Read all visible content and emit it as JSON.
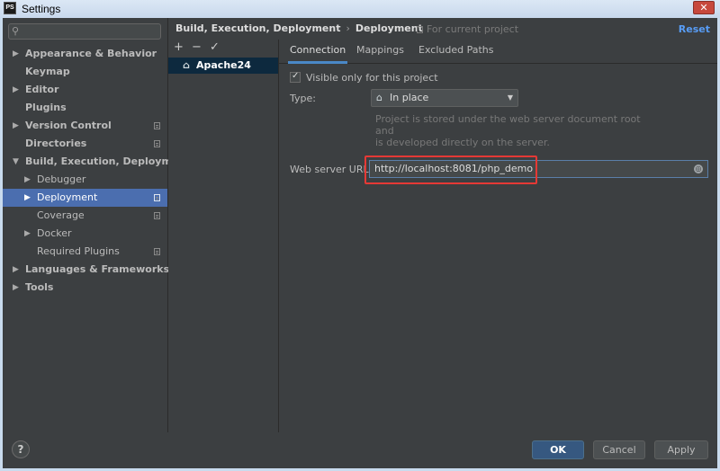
{
  "window": {
    "title": "Settings",
    "close_glyph": "✕"
  },
  "sidebar": {
    "search_placeholder": "",
    "items": [
      {
        "label": "Appearance & Behavior"
      },
      {
        "label": "Keymap"
      },
      {
        "label": "Editor"
      },
      {
        "label": "Plugins"
      },
      {
        "label": "Version Control"
      },
      {
        "label": "Directories"
      },
      {
        "label": "Build, Execution, Deployment"
      },
      {
        "label": "Debugger"
      },
      {
        "label": "Deployment"
      },
      {
        "label": "Coverage"
      },
      {
        "label": "Docker"
      },
      {
        "label": "Required Plugins"
      },
      {
        "label": "Languages & Frameworks"
      },
      {
        "label": "Tools"
      }
    ],
    "selected": "Deployment"
  },
  "header": {
    "breadcrumb": [
      "Build, Execution, Deployment",
      "Deployment"
    ],
    "breadcrumb_separator": "›",
    "scope_note": "For current project",
    "reset_label": "Reset"
  },
  "server_list": {
    "toolbar": {
      "add": "+",
      "remove": "−",
      "apply": "✓"
    },
    "items": [
      {
        "label": "Apache24",
        "selected": true
      }
    ]
  },
  "tabs": [
    {
      "label": "Connection",
      "active": true
    },
    {
      "label": "Mappings",
      "active": false
    },
    {
      "label": "Excluded Paths",
      "active": false
    }
  ],
  "connection": {
    "visible_only_label": "Visible only for this project",
    "visible_only_checked": true,
    "type_label": "Type:",
    "type_value": "In place",
    "type_hint_line1": "Project is stored under the web server document root and",
    "type_hint_line2": "is developed directly on the server.",
    "url_label": "Web server URL:",
    "url_value": "http://localhost:8081/php_demo"
  },
  "buttons": {
    "help": "?",
    "ok": "OK",
    "cancel": "Cancel",
    "apply": "Apply"
  },
  "colors": {
    "accent": "#4b6eaf",
    "link": "#589df6",
    "highlight_box": "#e53935",
    "background": "#3c3f41"
  }
}
